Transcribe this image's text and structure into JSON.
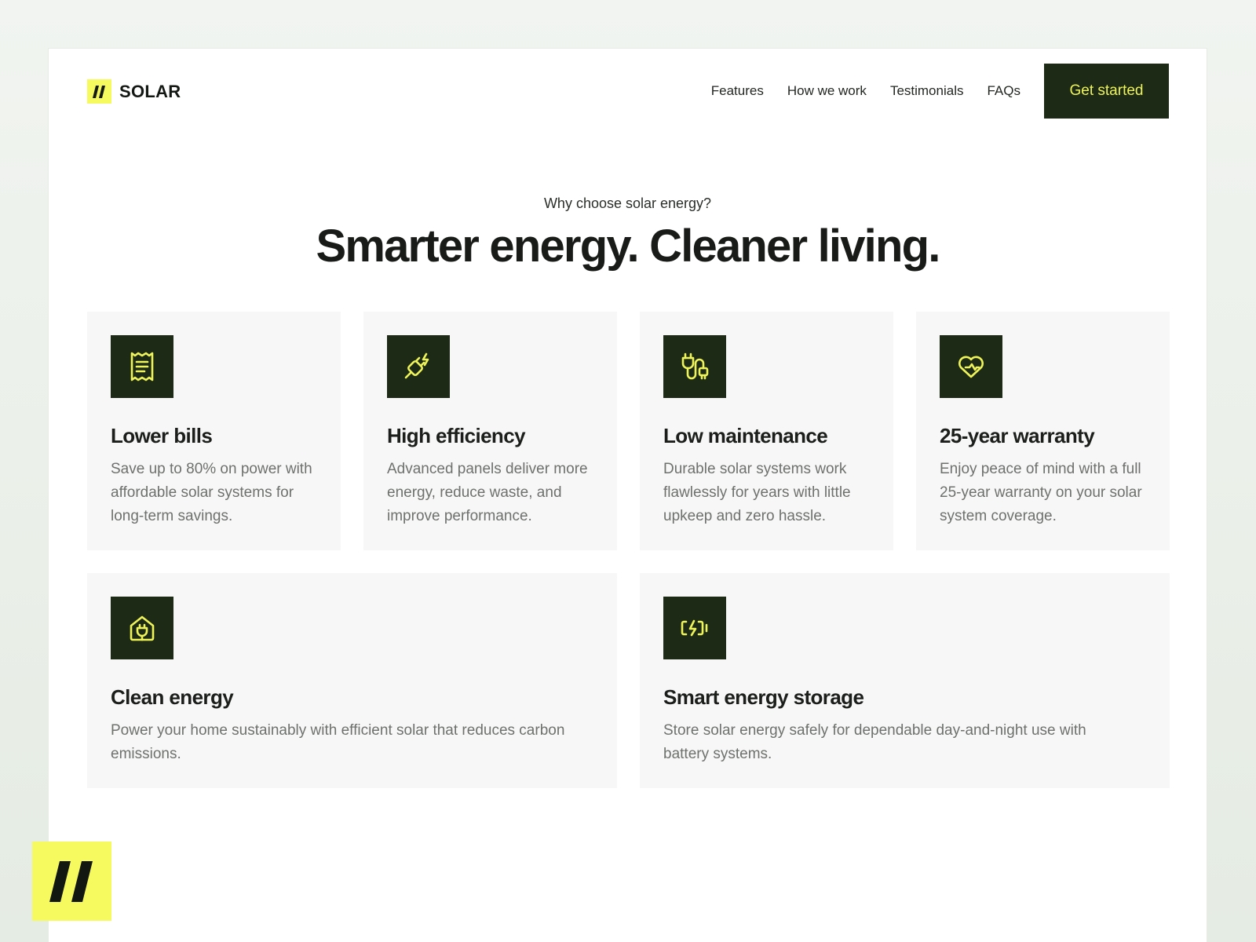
{
  "brand": {
    "name": "SOLAR",
    "logo_icon": "double-slash-logo",
    "accent": "#f7fa5f"
  },
  "nav": {
    "links": [
      "Features",
      "How we work",
      "Testimonials",
      "FAQs"
    ],
    "cta_label": "Get started"
  },
  "hero": {
    "eyebrow": "Why choose solar energy?",
    "headline": "Smarter energy. Cleaner living."
  },
  "features": [
    {
      "icon": "receipt-icon",
      "title": "Lower bills",
      "text": "Save up to 80% on power with affordable solar systems for long-term savings."
    },
    {
      "icon": "plug-bolt-icon",
      "title": "High efficiency",
      "text": "Advanced panels deliver more energy, reduce waste, and improve performance."
    },
    {
      "icon": "charging-cable-icon",
      "title": "Low maintenance",
      "text": "Durable solar systems work flawlessly for years with little upkeep and zero hassle."
    },
    {
      "icon": "heart-shield-icon",
      "title": "25-year warranty",
      "text": "Enjoy peace of mind with a full 25-year warranty on your solar system coverage."
    },
    {
      "icon": "eco-home-icon",
      "title": "Clean energy",
      "text": "Power your home sustainably with efficient solar that reduces carbon emissions."
    },
    {
      "icon": "battery-charge-icon",
      "title": "Smart energy storage",
      "text": "Store solar energy safely for dependable day-and-night use with battery systems."
    }
  ],
  "colors": {
    "dark_green": "#1c2a16",
    "icon_yellow": "#eef35a",
    "card_bg": "#f7f7f7"
  }
}
